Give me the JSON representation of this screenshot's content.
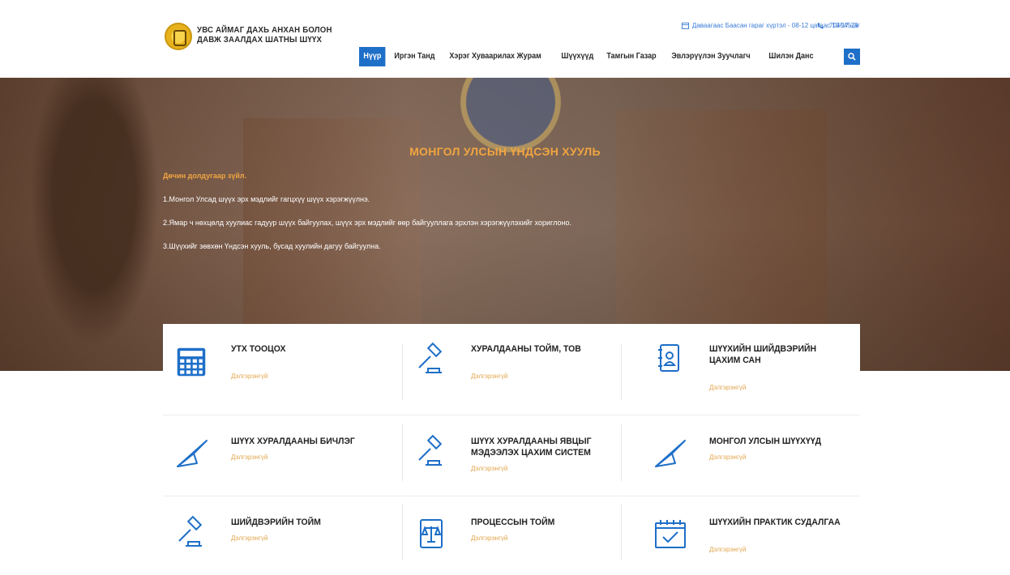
{
  "header": {
    "brand_line1": "УВС АЙМАГ ДАХЬ АНХАН БОЛОН",
    "brand_line2": "ДАВЖ ЗААЛДАХ ШАТНЫ ШҮҮХ",
    "schedule_text": "Даваагаас Баасан гараг хүртэл - 08-12 цагаас 13-17 цаг",
    "phone": "70454579",
    "nav": [
      {
        "label": "Нүүр",
        "active": true
      },
      {
        "label": "Иргэн Танд"
      },
      {
        "label": "Хэрэг Хуваарилах Журам"
      },
      {
        "label": "Шүүхүүд"
      },
      {
        "label": "Тамгын Газар"
      },
      {
        "label": "Эвлэрүүлэн Зуучлагч"
      },
      {
        "label": "Шилэн Данс"
      }
    ],
    "accent_color": "#1e6fc8"
  },
  "hero": {
    "title": "МОНГОЛ УЛСЫН ҮНДСЭН ХУУЛЬ",
    "subtitle": "Дөчин долдугаар зүйл.",
    "lines": [
      "1.Монгол Улсад шүүх эрх мэдлийг гагцхүү шүүх хэрэгжүүлнэ.",
      "2.Ямар ч нөхцөлд хуулиас гадуур шүүх байгуулах, шүүх эрх мэдлийг өөр байгууллага эрхлэн хэрэгжүүлэхийг хориглоно.",
      "3.Шүүхийг зөвхөн Үндсэн хууль, бусад хуулийн дагуу байгуулна."
    ],
    "title_color": "#f0a541"
  },
  "cards": [
    {
      "title": "УТХ ТООЦОХ",
      "more": "Дэлгэрэнгүй",
      "icon": "calculator-icon"
    },
    {
      "title": "ХУРАЛДААНЫ ТОЙМ, ТОВ",
      "more": "Дэлгэрэнгүй",
      "icon": "gavel-icon"
    },
    {
      "title": "ШҮҮХИЙН ШИЙДВЭРИЙН ЦАХИМ САН",
      "more": "Дэлгэрэнгүй",
      "icon": "address-book-icon"
    },
    {
      "title": "ШҮҮХ ХУРАЛДААНЫ БИЧЛЭГ",
      "more": "Дэлгэрэнгүй",
      "icon": "paper-plane-icon"
    },
    {
      "title": "ШҮҮХ ХУРАЛДААНЫ ЯВЦЫГ МЭДЭЭЛЭХ ЦАХИМ СИСТЕМ",
      "more": "Дэлгэрэнгүй",
      "icon": "gavel-icon"
    },
    {
      "title": "МОНГОЛ УЛСЫН ШҮҮХҮҮД",
      "more": "Дэлгэрэнгүй",
      "icon": "paper-plane-icon"
    },
    {
      "title": "ШИЙДВЭРИЙН ТОЙМ",
      "more": "Дэлгэрэнгүй",
      "icon": "gavel-icon"
    },
    {
      "title": "ПРОЦЕССЫН ТОЙМ",
      "more": "Дэлгэрэнгүй",
      "icon": "scales-document-icon"
    },
    {
      "title": "ШҮҮХИЙН ПРАКТИК СУДАЛГАА",
      "more": "Дэлгэрэнгүй",
      "icon": "calendar-check-icon"
    }
  ]
}
